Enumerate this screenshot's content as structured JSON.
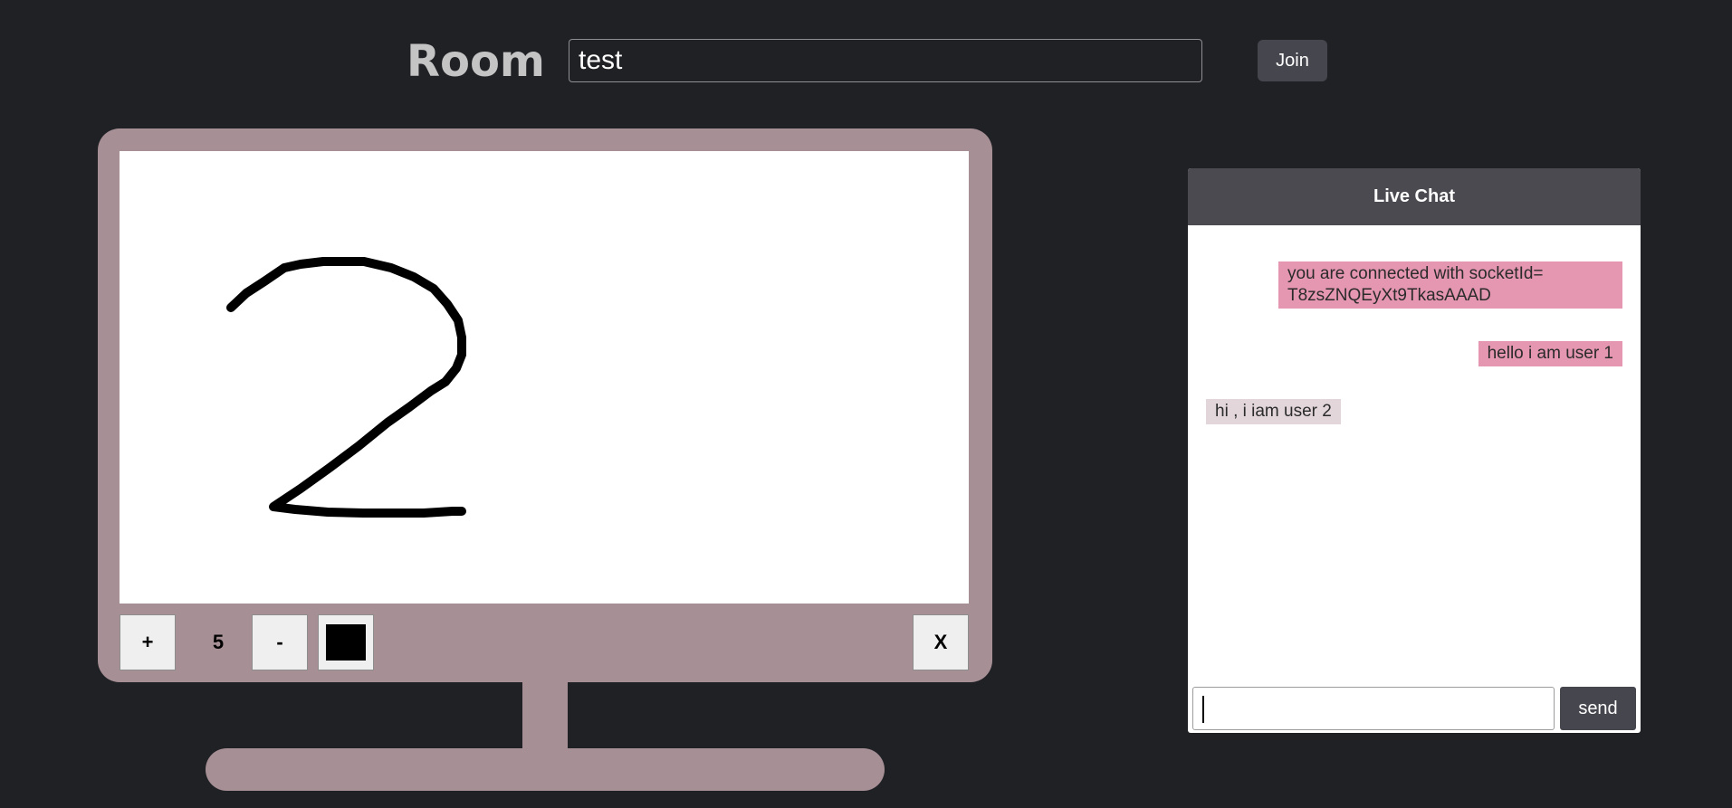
{
  "header": {
    "room_label": "Room",
    "room_input_value": "test",
    "join_label": "Join"
  },
  "whiteboard": {
    "plus_label": "+",
    "size_value": "5",
    "minus_label": "-",
    "clear_label": "X",
    "brush_color": "#000000",
    "drawing": "handwritten digit 2"
  },
  "chat": {
    "title": "Live Chat",
    "messages": [
      {
        "text": "you are connected with socketId= T8zsZNQEyXt9TkasAAAD",
        "side": "right"
      },
      {
        "text": "hello i am user 1",
        "side": "right"
      },
      {
        "text": "hi , i iam user 2",
        "side": "left"
      }
    ],
    "input_value": "",
    "send_label": "send"
  },
  "colors": {
    "background": "#202125",
    "monitor": "#a69096",
    "own_message": "#e596b1",
    "other_message": "#e2d6da",
    "button": "#46464e"
  }
}
